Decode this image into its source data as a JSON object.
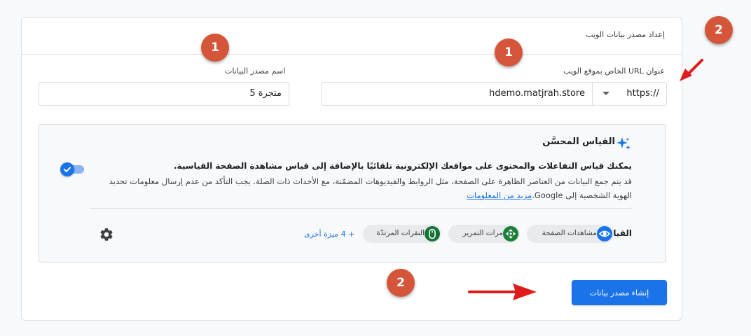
{
  "card": {
    "title": "إعداد مصدر بيانات الويب"
  },
  "form": {
    "url_label": "عنوان URL الخاص بموقع الويب",
    "url_prefix": "https://",
    "url_value": "hdemo.matjrah.store",
    "name_label": "اسم مصدر البيانات",
    "name_value": "متجرة 5"
  },
  "enhanced_measurement": {
    "title": "القياس المحسَّن",
    "bold_text": "يمكنك قياس التفاعلات والمحتوى على مواقعك الإلكترونية تلقائيًا بالإضافة إلى قياس مشاهدة الصفحة القياسية.",
    "description": "قد يتم جمع البيانات من العناصر الظاهرة على الصفحة، مثل الروابط والفيديوهات المضمّنة، مع الأحداث ذات الصلة. يجب التأكد من عدم إرسال معلومات تحديد الهوية الشخصية إلى Google.",
    "learn_more": "مزيد من المعلومات",
    "toggle_on": true,
    "measuring_label": "القياس:",
    "chips": {
      "page_views": "مشاهدات الصفحة",
      "scrolls": "مرات التمرير",
      "outbound_clicks": "النقرات المرتدّة"
    },
    "more_features": "+ 4 ميزة أخرى"
  },
  "actions": {
    "create_label": "إنشاء مصدر بيانات"
  },
  "annotations": {
    "badge_1": "1",
    "badge_2": "2",
    "color": "#d4553a",
    "arrow_color": "#e01b1b"
  },
  "colors": {
    "primary": "#1a73e8",
    "toggle_track": "#8ab4f8"
  }
}
